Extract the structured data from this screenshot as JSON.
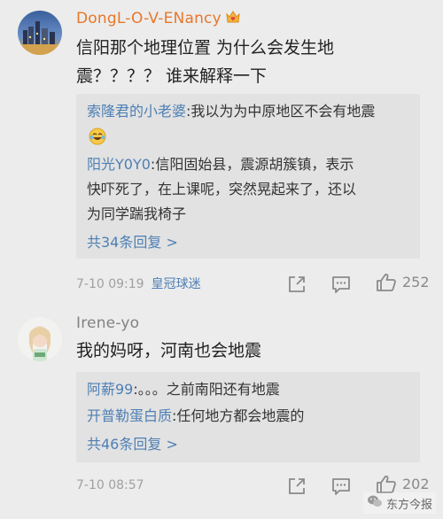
{
  "comments": [
    {
      "username": "DongL-O-V-ENancy",
      "text_lines": [
        "信阳那个地理位置 为什么会发生地",
        "震？？？？ 谁来解释一下"
      ],
      "replies": [
        {
          "name": "索隆君的小老婆",
          "text": ":我以为为中原地区不会有地震"
        },
        {
          "name": "阳光Y0Y0",
          "text": ":信阳固始县，震源胡簇镇，表示"
        },
        {
          "name": "",
          "text": "快吓死了，在上课呢，突然晃起来了，还以"
        },
        {
          "name": "",
          "text": "为同学踹我椅子"
        }
      ],
      "more_replies": "共34条回复 >",
      "time": "7-10 09:19",
      "source": "皇冠球迷",
      "like_count": "252"
    },
    {
      "username": "Irene-yo",
      "text_lines": [
        "我的妈呀，河南也会地震"
      ],
      "replies": [
        {
          "name": "阿薪99",
          "text": ":。。。之前南阳还有地震"
        },
        {
          "name": "开普勒蛋白质",
          "text": ":任何地方都会地震的"
        }
      ],
      "more_replies": "共46条回复 >",
      "time": "7-10 08:57",
      "source": "",
      "like_count": "202"
    }
  ],
  "watermark": {
    "text": "东方今报"
  },
  "icons": {
    "badge": "crown-heart-badge-icon",
    "emoji": "laughing-crying-emoji-icon",
    "share": "share-icon",
    "comment": "comment-icon",
    "like": "thumbs-up-icon"
  },
  "colors": {
    "background": "#ececec",
    "reply_box": "#e2e2e2",
    "username_highlight": "#e7772a",
    "link_blue": "#4e7fb4",
    "meta_gray": "#a0a0a0"
  }
}
